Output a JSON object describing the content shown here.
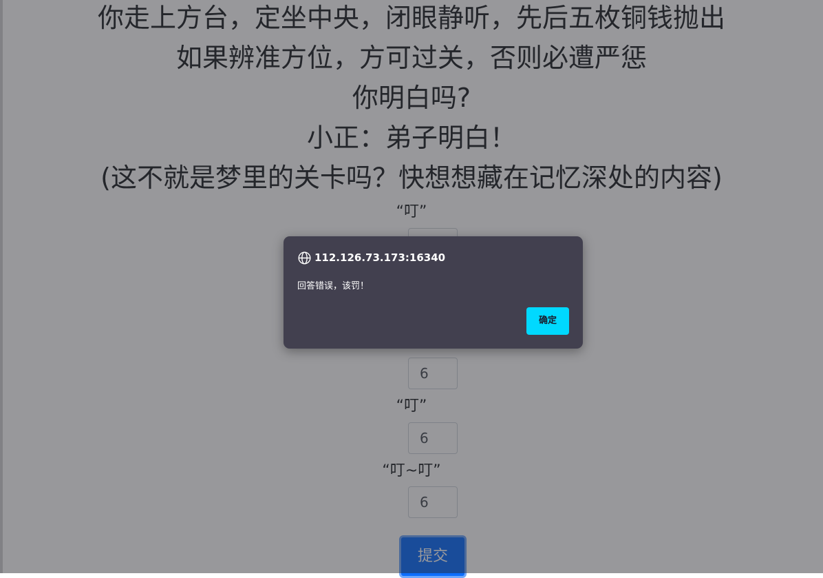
{
  "story": {
    "lines": [
      "你走上方台，定坐中央，闭眼静听，先后五枚铜钱抛出",
      "如果辨准方位，方可过关，否则必遭严惩",
      "你明白吗?",
      "小正：弟子明白！",
      "(这不就是梦里的关卡吗？快想想藏在记忆深处的内容)"
    ]
  },
  "form": {
    "items": [
      {
        "label": "“叮”",
        "value": ""
      },
      {
        "label": "",
        "value": "6"
      },
      {
        "label": "“叮”",
        "value": "6"
      },
      {
        "label": "“叮~叮”",
        "value": "6"
      }
    ],
    "submit_label": "提交"
  },
  "dialog": {
    "origin": "112.126.73.173:16340",
    "message": "回答错误，该罚！",
    "ok_label": "确定",
    "icon": "globe-icon"
  },
  "colors": {
    "dialog_bg": "#42404f",
    "ok_button": "#00d9ff",
    "submit_button": "#0d6efd"
  }
}
